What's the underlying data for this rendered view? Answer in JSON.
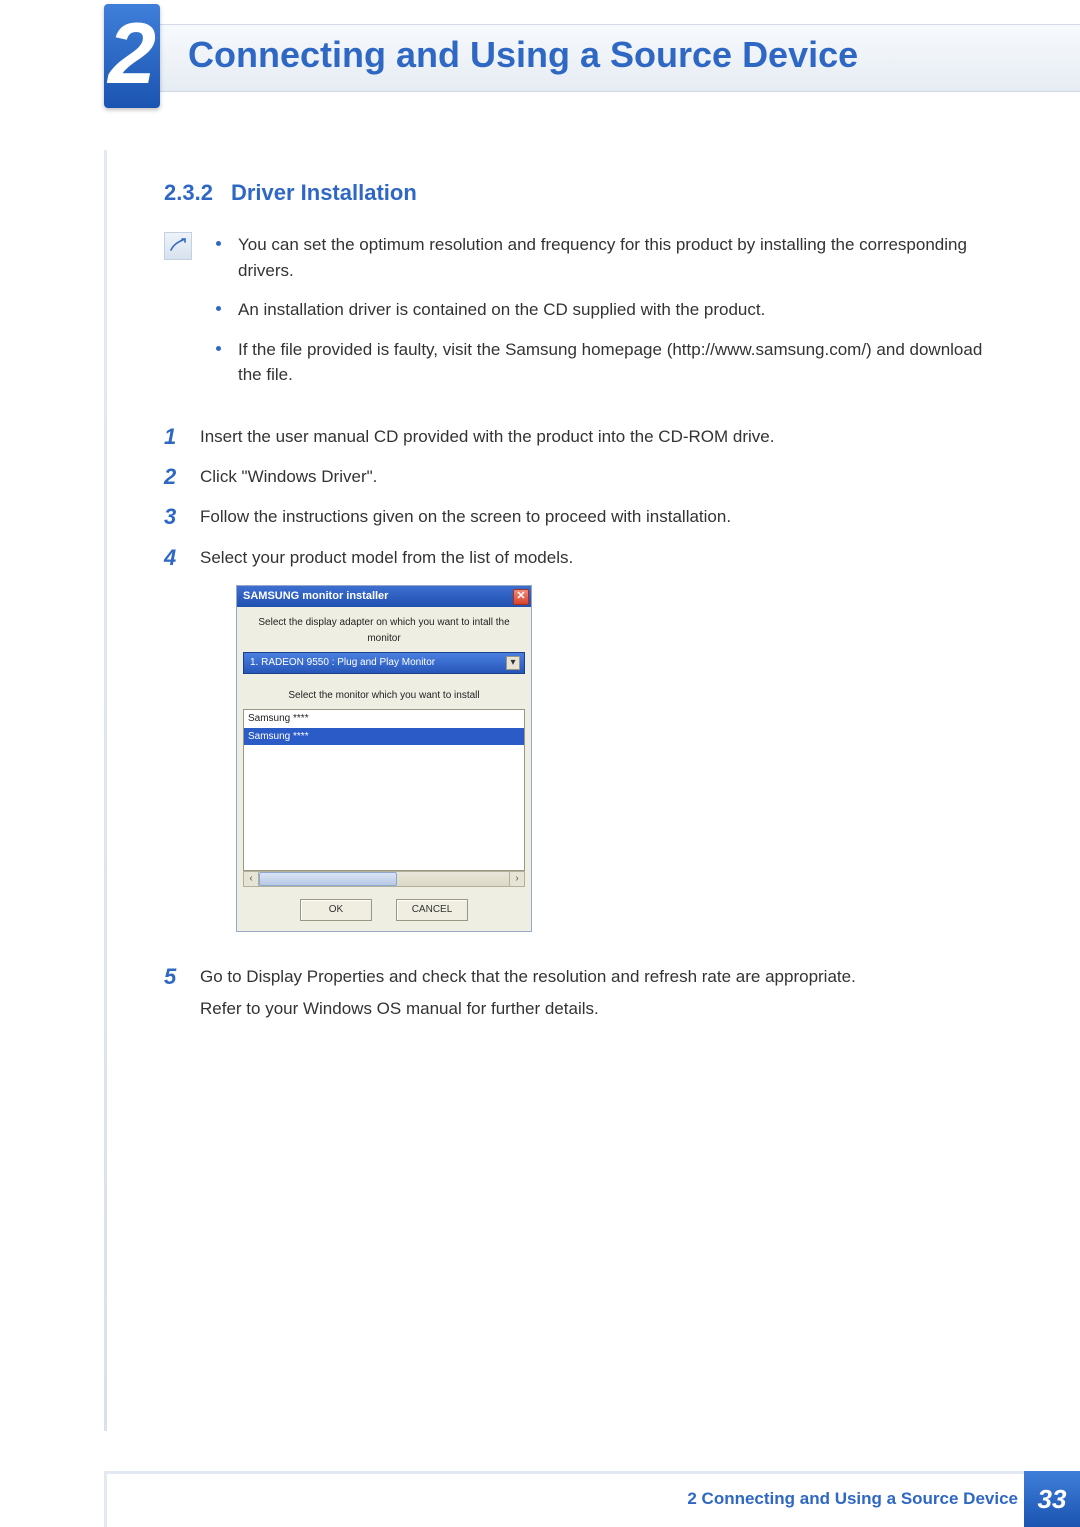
{
  "header": {
    "chapter_number": "2",
    "chapter_title": "Connecting and Using a Source Device"
  },
  "section": {
    "number": "2.3.2",
    "title": "Driver Installation"
  },
  "note_bullets": [
    "You can set the optimum resolution and frequency for this product by installing the corresponding drivers.",
    "An installation driver is contained on the CD supplied with the product.",
    "If the file provided is faulty, visit the Samsung homepage (http://www.samsung.com/) and download the file."
  ],
  "steps": [
    {
      "n": "1",
      "text": "Insert the user manual CD provided with the product into the CD-ROM drive."
    },
    {
      "n": "2",
      "text": "Click \"Windows Driver\"."
    },
    {
      "n": "3",
      "text": "Follow the instructions given on the screen to proceed with installation."
    },
    {
      "n": "4",
      "text": "Select your product model from the list of models."
    },
    {
      "n": "5",
      "text": "Go to Display Properties and check that the resolution and refresh rate are appropriate.",
      "sub": "Refer to your Windows OS manual for further details."
    }
  ],
  "dialog": {
    "title": "SAMSUNG monitor installer",
    "close": "✕",
    "label1": "Select the display adapter on which you want to intall the monitor",
    "dropdown_value": "1. RADEON 9550 : Plug and Play Monitor",
    "dropdown_arrow": "▾",
    "label2": "Select the monitor which you want to install",
    "list_items": [
      "Samsung ****",
      "Samsung ****"
    ],
    "scroll_left": "‹",
    "scroll_right": "›",
    "ok": "OK",
    "cancel": "CANCEL"
  },
  "footer": {
    "label": "2 Connecting and Using a Source Device",
    "page": "33"
  }
}
